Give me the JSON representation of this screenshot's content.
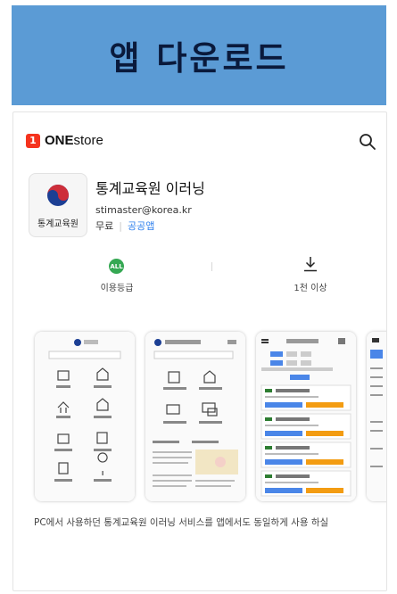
{
  "banner": {
    "title": "앱 다운로드",
    "color": "#5b9bd5"
  },
  "store": {
    "logo_number": "1",
    "brand_bold": "ONE",
    "brand_rest": "store",
    "search_icon": "search-icon"
  },
  "app": {
    "icon_label": "통계교육원",
    "title": "통계교육원 이러닝",
    "developer": "stimaster@korea.kr",
    "price": "무료",
    "separator": "|",
    "category": "공공앱"
  },
  "stats": {
    "rating_badge": "ALL",
    "rating_label": "이용등급",
    "download_icon": "download-icon",
    "downloads_label": "1천 이상"
  },
  "description": "PC에서 사용하던 통계교육원 이러닝 서비스를 앱에서도 동일하게 사용 하실"
}
